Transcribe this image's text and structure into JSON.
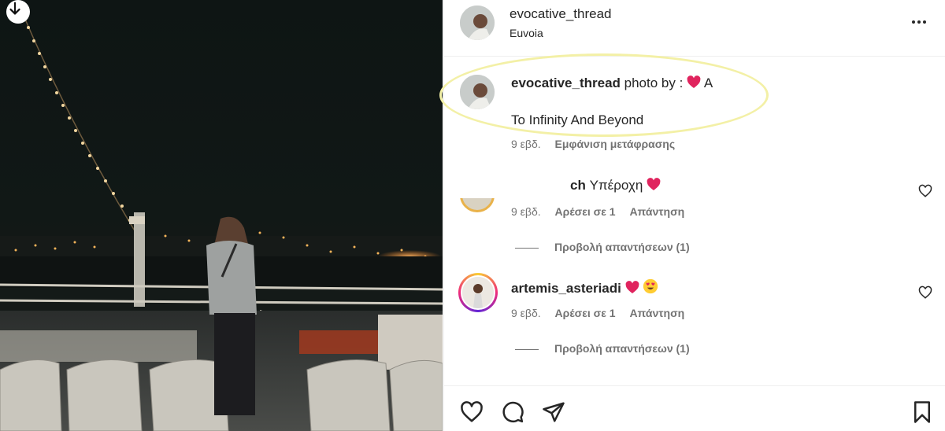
{
  "post": {
    "username": "evocative_thread",
    "location": "Euvoia"
  },
  "caption": {
    "username": "evocative_thread",
    "text_before": "photo by : ",
    "text_after": "A",
    "body": "To Infinity And Beyond",
    "time": "9 εβδ.",
    "translate": "Εμφάνιση μετάφρασης"
  },
  "comments": [
    {
      "username_visible": "ch",
      "text": "Υπέροχη",
      "time": "9 εβδ.",
      "likes": "Αρέσει σε 1",
      "reply": "Απάντηση",
      "view_replies": "Προβολή απαντήσεων (1)"
    },
    {
      "username": "artemis_asteriadi",
      "time": "9 εβδ.",
      "likes": "Αρέσει σε 1",
      "reply": "Απάντηση",
      "view_replies": "Προβολή απαντήσεων (1)"
    }
  ],
  "icons": {
    "download": "arrow-down-icon",
    "more": "more-options-icon",
    "like": "heart-icon",
    "comment": "comment-icon",
    "share": "paper-plane-icon",
    "save": "bookmark-icon",
    "emoji_heart": "red-heart-emoji",
    "emoji_hearteyes": "heart-eyes-emoji"
  },
  "colors": {
    "text": "#262626",
    "secondary": "#737373",
    "heart": "#e0245e",
    "highlight": "#f3f0a6"
  }
}
